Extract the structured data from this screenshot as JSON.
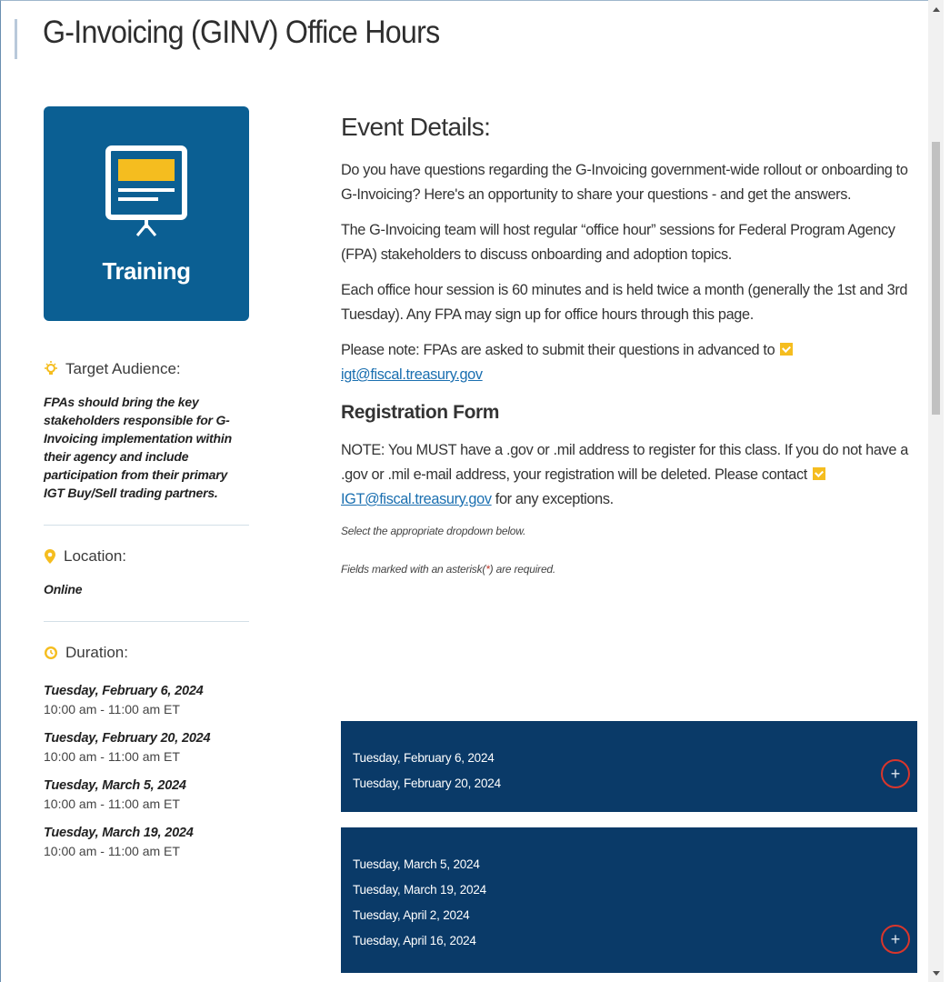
{
  "page": {
    "title": "G-Invoicing (GINV) Office Hours"
  },
  "training_card": {
    "label": "Training",
    "icon": "presentation-board-icon",
    "color": "#0b5f93"
  },
  "target_audience": {
    "heading": "Target Audience:",
    "icon": "lightbulb-icon",
    "text": "FPAs should bring the key stakeholders responsible for G-Invoicing implementation within their agency and include participation from their primary IGT Buy/Sell trading partners."
  },
  "location": {
    "heading": "Location:",
    "icon": "map-pin-icon",
    "text": "Online"
  },
  "duration": {
    "heading": "Duration:",
    "icon": "clock-icon",
    "items": [
      {
        "date": "Tuesday, February 6, 2024",
        "time": "10:00 am - 11:00 am ET"
      },
      {
        "date": "Tuesday, February 20, 2024",
        "time": "10:00 am - 11:00 am ET"
      },
      {
        "date": "Tuesday, March 5, 2024",
        "time": "10:00 am - 11:00 am ET"
      },
      {
        "date": "Tuesday, March 19, 2024",
        "time": "10:00 am - 11:00 am ET"
      }
    ]
  },
  "event_details": {
    "heading": "Event Details:",
    "p1": "Do you have questions regarding the G-Invoicing government-wide rollout or onboarding to G-Invoicing? Here's an opportunity to share your questions - and get the answers.",
    "p2": "The G-Invoicing team will host regular “office hour” sessions for Federal Program Agency (FPA) stakeholders to discuss onboarding and adoption topics.",
    "p3": "Each office hour session is 60 minutes and is held twice a month (generally the 1st and 3rd Tuesday). Any FPA may sign up for office hours through this page.",
    "p4_prefix": "Please note: FPAs are asked to submit their questions in advanced to",
    "p4_email": "igt@fiscal.treasury.gov"
  },
  "registration": {
    "heading": "Registration Form",
    "note_prefix": "NOTE: You MUST have a .gov or .mil address to register for this class. If you do not have a .gov or .mil e-mail address, your registration will be deleted. Please contact",
    "note_email": "IGT@fiscal.treasury.gov",
    "note_suffix": "for any exceptions.",
    "instruction1": "Select the appropriate dropdown below.",
    "instruction2_prefix": "Fields marked with an asterisk(",
    "instruction2_star": "*",
    "instruction2_suffix": ") are required."
  },
  "date_groups": [
    {
      "dates": [
        "Tuesday, February 6, 2024",
        "Tuesday, February 20, 2024"
      ],
      "expand_label": "+"
    },
    {
      "dates": [
        "Tuesday, March 5, 2024",
        "Tuesday, March 19, 2024",
        "Tuesday, April 2, 2024",
        "Tuesday, April 16, 2024"
      ],
      "expand_label": "+"
    }
  ],
  "colors": {
    "panel": "#0a3a68",
    "accent_yellow": "#f5bd1f",
    "link": "#1a6fb0",
    "highlight_circle": "#d9362c"
  }
}
